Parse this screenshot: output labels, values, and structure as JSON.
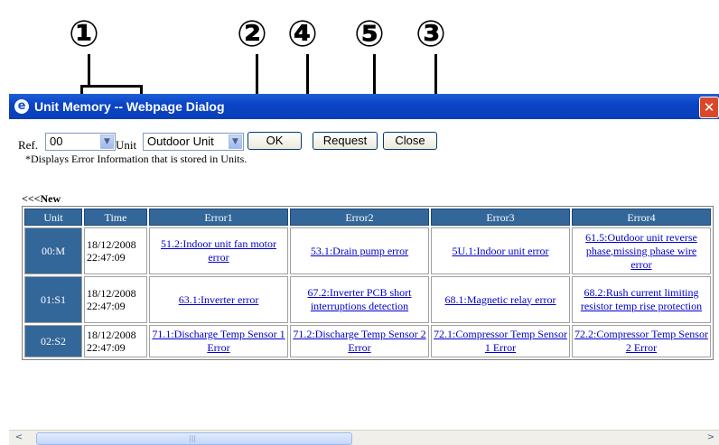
{
  "callouts": [
    "①",
    "②",
    "④",
    "⑤",
    "③"
  ],
  "window": {
    "title": "Unit Memory -- Webpage Dialog",
    "title_icon": "e",
    "close_glyph": "✕"
  },
  "controls": {
    "ref_label": "Ref.",
    "ref_value": "00",
    "unit_label": "Unit",
    "unit_value": "Outdoor Unit",
    "ok_label": "OK",
    "request_label": "Request",
    "close_label": "Close",
    "note": "*Displays Error Information that is stored in Units."
  },
  "new_marker": "<<<New",
  "table": {
    "headers": [
      "Unit",
      "Time",
      "Error1",
      "Error2",
      "Error3",
      "Error4"
    ],
    "rows": [
      {
        "unit": "00:M",
        "date": "18/12/2008",
        "time": "22:47:09",
        "errors": [
          "51.2:Indoor unit fan motor error",
          "53.1:Drain pump error",
          "5U.1:Indoor unit error",
          "61.5:Outdoor unit reverse phase,missing phase wire error"
        ]
      },
      {
        "unit": "01:S1",
        "date": "18/12/2008",
        "time": "22:47:09",
        "errors": [
          "63.1:Inverter error",
          "67.2:Inverter PCB short interruptions detection",
          "68.1:Magnetic relay error",
          "68.2:Rush current limiting resistor temp rise protection"
        ]
      },
      {
        "unit": "02:S2",
        "date": "18/12/2008",
        "time": "22:47:09",
        "errors": [
          "71.1:Discharge Temp Sensor 1 Error",
          "71.2:Discharge Temp Sensor 2 Error",
          "72.1:Compressor Temp Sensor 1 Error",
          "72.2:Compressor Temp Sensor 2 Error"
        ]
      }
    ]
  },
  "icons": {
    "dropdown": "▼",
    "scroll_left": "<",
    "scroll_right": ">",
    "grip": "|||"
  }
}
